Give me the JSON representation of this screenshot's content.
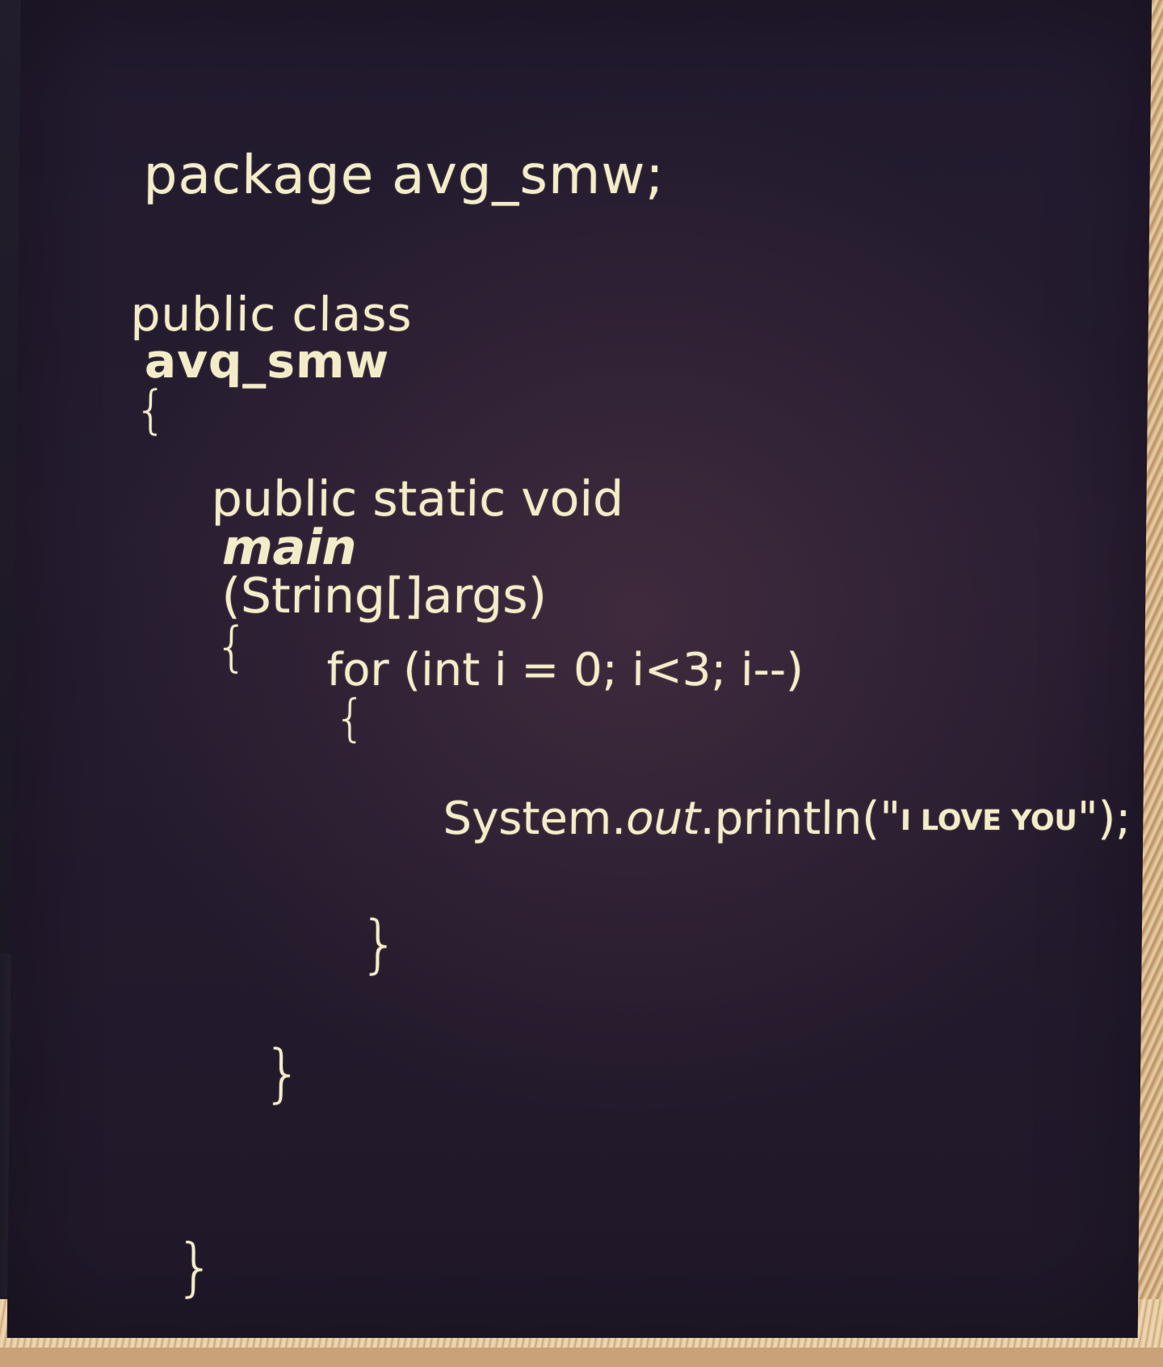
{
  "poster": {
    "line_package": "package avg_smw;",
    "line_class_prefix": "public class",
    "line_class_name": "avq_smw",
    "line_class_open": "{",
    "line_main_prefix": "public static void",
    "line_main_name": "main",
    "line_main_args": "(String[]args)",
    "line_main_open": "{",
    "line_for": "for (int i = 0; i<3; i--)",
    "line_for_open": "{",
    "line_print_prefix": "System.",
    "line_print_out": "out",
    "line_print_call": ".println(\"",
    "line_print_string": "I LOVE YOU",
    "line_print_end": "\");",
    "close_for": "}",
    "close_main": "}",
    "close_class": "}"
  }
}
